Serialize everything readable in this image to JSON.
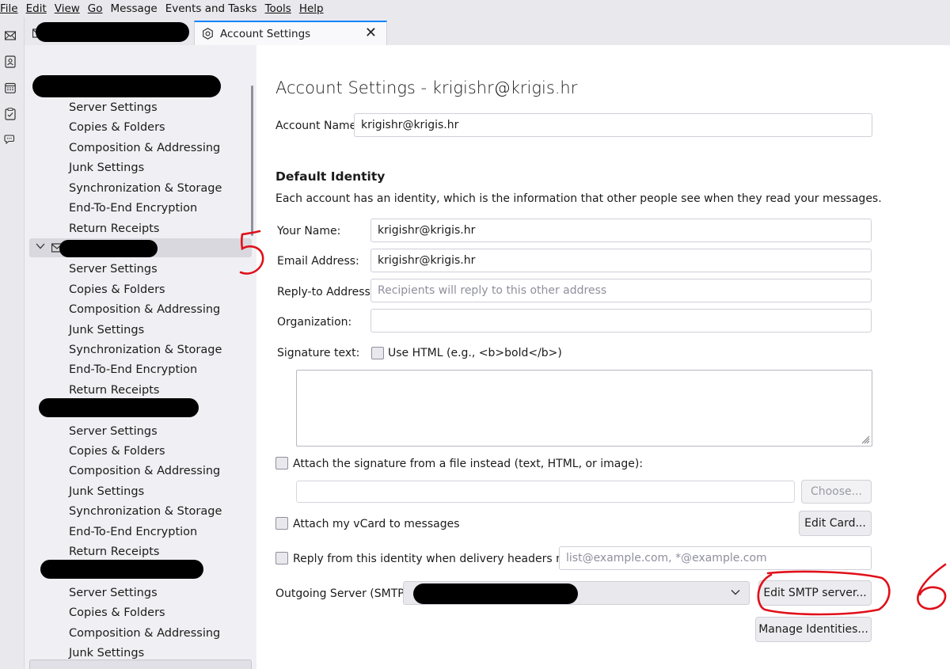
{
  "menubar": {
    "items": [
      "File",
      "Edit",
      "View",
      "Go",
      "Message",
      "Events and Tasks",
      "Tools",
      "Help"
    ]
  },
  "tabs": {
    "active_label": "Account Settings",
    "close_glyph": "✕"
  },
  "spaces": {
    "icons": [
      "mail-icon",
      "address-book-icon",
      "calendar-icon",
      "tasks-icon",
      "chat-icon"
    ]
  },
  "sidebar": {
    "group1": [
      "Server Settings",
      "Copies & Folders",
      "Composition & Addressing",
      "Junk Settings",
      "Synchronization & Storage",
      "End-To-End Encryption",
      "Return Receipts"
    ],
    "group2": [
      "Server Settings",
      "Copies & Folders",
      "Composition & Addressing",
      "Junk Settings",
      "Synchronization & Storage",
      "End-To-End Encryption",
      "Return Receipts"
    ],
    "group3": [
      "Server Settings",
      "Copies & Folders",
      "Composition & Addressing",
      "Junk Settings",
      "Synchronization & Storage",
      "End-To-End Encryption",
      "Return Receipts"
    ],
    "group4": [
      "Server Settings",
      "Copies & Folders",
      "Composition & Addressing",
      "Junk Settings"
    ]
  },
  "main": {
    "title": "Account Settings - krigishr@krigis.hr",
    "account_name_label": "Account Name:",
    "account_name_value": "krigishr@krigis.hr",
    "default_identity_heading": "Default Identity",
    "default_identity_desc": "Each account has an identity, which is the information that other people see when they read your messages.",
    "your_name_label": "Your Name:",
    "your_name_value": "krigishr@krigis.hr",
    "email_label": "Email Address:",
    "email_value": "krigishr@krigis.hr",
    "reply_to_label": "Reply-to Address:",
    "reply_to_placeholder": "Recipients will reply to this other address",
    "organization_label": "Organization:",
    "organization_value": "",
    "signature_label": "Signature text:",
    "use_html_label": "Use HTML (e.g., <b>bold</b>)",
    "attach_sig_label": "Attach the signature from a file instead (text, HTML, or image):",
    "choose_button": "Choose...",
    "attach_vcard_label": "Attach my vCard to messages",
    "edit_card_button": "Edit Card...",
    "reply_from_label": "Reply from this identity when delivery headers match:",
    "reply_from_placeholder": "list@example.com, *@example.com",
    "outgoing_label": "Outgoing Server (SMTP):",
    "edit_smtp_button": "Edit SMTP server...",
    "manage_identities_button": "Manage Identities..."
  },
  "annotations": {
    "mark1": "5",
    "mark2": "6",
    "color": "#e0101a"
  }
}
